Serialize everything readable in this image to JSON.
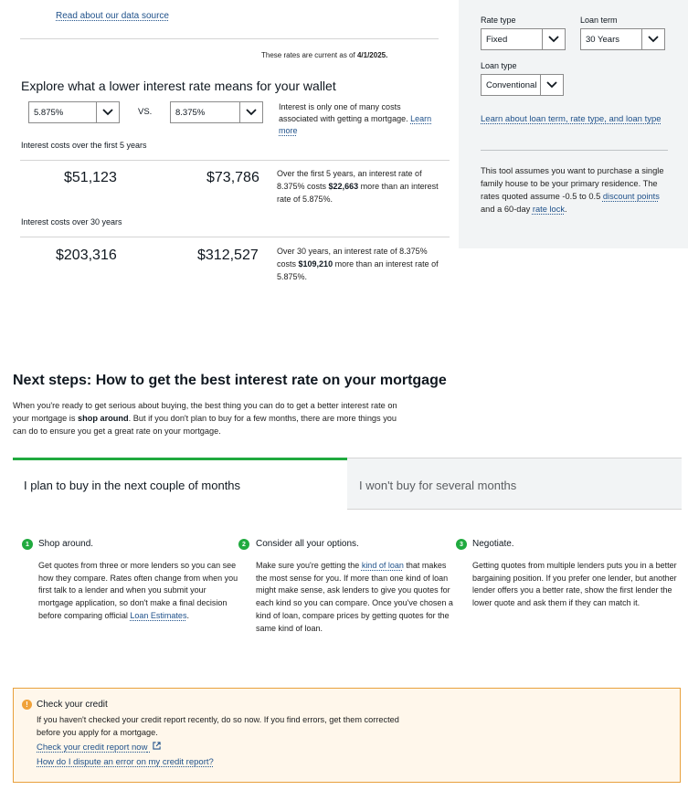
{
  "top": {
    "data_source_link": "Read about our data source",
    "rates_current_prefix": "These rates are current as of",
    "rates_current_date": "4/1/2025."
  },
  "explore": {
    "title": "Explore what a lower interest rate means for your wallet",
    "rate_a": "5.875%",
    "vs": "VS.",
    "rate_b": "8.375%",
    "note": "Interest is only one of many costs associated with getting a mortgage.",
    "learn_more": "Learn more"
  },
  "costs": {
    "label_5yr": "Interest costs over the first 5 years",
    "cost_5yr_a": "$51,123",
    "cost_5yr_b": "$73,786",
    "note_5yr_pre": "Over the first 5 years, an interest rate of 8.375% costs",
    "note_5yr_amount": "$22,663",
    "note_5yr_post": "more than an interest rate of 5.875%.",
    "label_30yr": "Interest costs over 30 years",
    "cost_30yr_a": "$203,316",
    "cost_30yr_b": "$312,527",
    "note_30yr_pre": "Over 30 years, an interest rate of 8.375% costs",
    "note_30yr_amount": "$109,210",
    "note_30yr_post": "more than an interest rate of 5.875%."
  },
  "panel": {
    "rate_type_label": "Rate type",
    "rate_type_value": "Fixed",
    "loan_term_label": "Loan term",
    "loan_term_value": "30 Years",
    "loan_type_label": "Loan type",
    "loan_type_value": "Conventional",
    "loan_term_link": "Learn about loan term, rate type, and loan type",
    "assumption_pre": "This tool assumes you want to purchase a single family house to be your primary residence. The rates quoted assume -0.5 to 0.5",
    "discount_points": "discount points",
    "assumption_mid": "and a 60-day",
    "rate_lock": "rate lock",
    "assumption_end": "."
  },
  "next_steps": {
    "title": "Next steps: How to get the best interest rate on your mortgage",
    "intro_pre": "When you're ready to get serious about buying, the best thing you can do to get a better interest rate on your mortgage is",
    "intro_bold": "shop around",
    "intro_post": ". But if you don't plan to buy for a few months, there are more things you can do to ensure you get a great rate on your mortgage.",
    "tab_active": "I plan to buy in the next couple of months",
    "tab_inactive": "I won't buy for several months"
  },
  "steps": [
    {
      "num": "1",
      "title": "Shop around.",
      "body": "Get quotes from three or more lenders so you can see how they compare. Rates often change from when you first talk to a lender and when you submit your mortgage application, so don't make a final decision before comparing official",
      "link": "Loan Estimates",
      "body_end": "."
    },
    {
      "num": "2",
      "title": "Consider all your options.",
      "body_pre": "Make sure you're getting the",
      "link": "kind of loan",
      "body": "that makes the most sense for you. If more than one kind of loan might make sense, ask lenders to give you quotes for each kind so you can compare. Once you've chosen a kind of loan, compare prices by getting quotes for the same kind of loan."
    },
    {
      "num": "3",
      "title": "Negotiate.",
      "body": "Getting quotes from multiple lenders puts you in a better bargaining position. If you prefer one lender, but another lender offers you a better rate, show the first lender the lower quote and ask them if they can match it."
    }
  ],
  "credit": {
    "icon": "!",
    "title": "Check your credit",
    "body": "If you haven't checked your credit report recently, do so now. If you find errors, get them corrected before you apply for a mortgage.",
    "link_1": "Check your credit report now",
    "link_2": "How do I dispute an error on my credit report?"
  },
  "colors": {
    "accent_green": "#20aa3f",
    "link_blue": "#20528b",
    "panel_bg": "#f2f4f5",
    "warning_orange": "#e8a03c",
    "warning_bg": "#fff7eb"
  },
  "icons": {
    "dropdown": "chevron-down-icon",
    "external": "external-link-icon",
    "warning": "warning-icon"
  }
}
